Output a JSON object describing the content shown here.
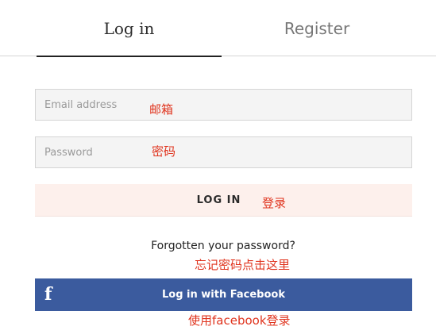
{
  "tabs": {
    "login_label": "Log in",
    "register_label": "Register"
  },
  "form": {
    "email_placeholder": "Email address",
    "email_value": "",
    "password_placeholder": "Password",
    "password_value": "",
    "login_button_label": "LOG IN",
    "forgot_link": "Forgotten your password?",
    "facebook_button_label": "Log in with Facebook",
    "facebook_icon_glyph": "f"
  },
  "annotations": {
    "email_note": "邮箱",
    "password_note": "密码",
    "login_note": "登录",
    "forgot_note": "忘记密码点击这里",
    "facebook_note": "使用facebook登录"
  },
  "colors": {
    "annotation": "#e0341e",
    "facebook_blue": "#3b5b9e",
    "login_button_bg": "#fdf0ec",
    "input_bg": "#f4f4f4"
  }
}
